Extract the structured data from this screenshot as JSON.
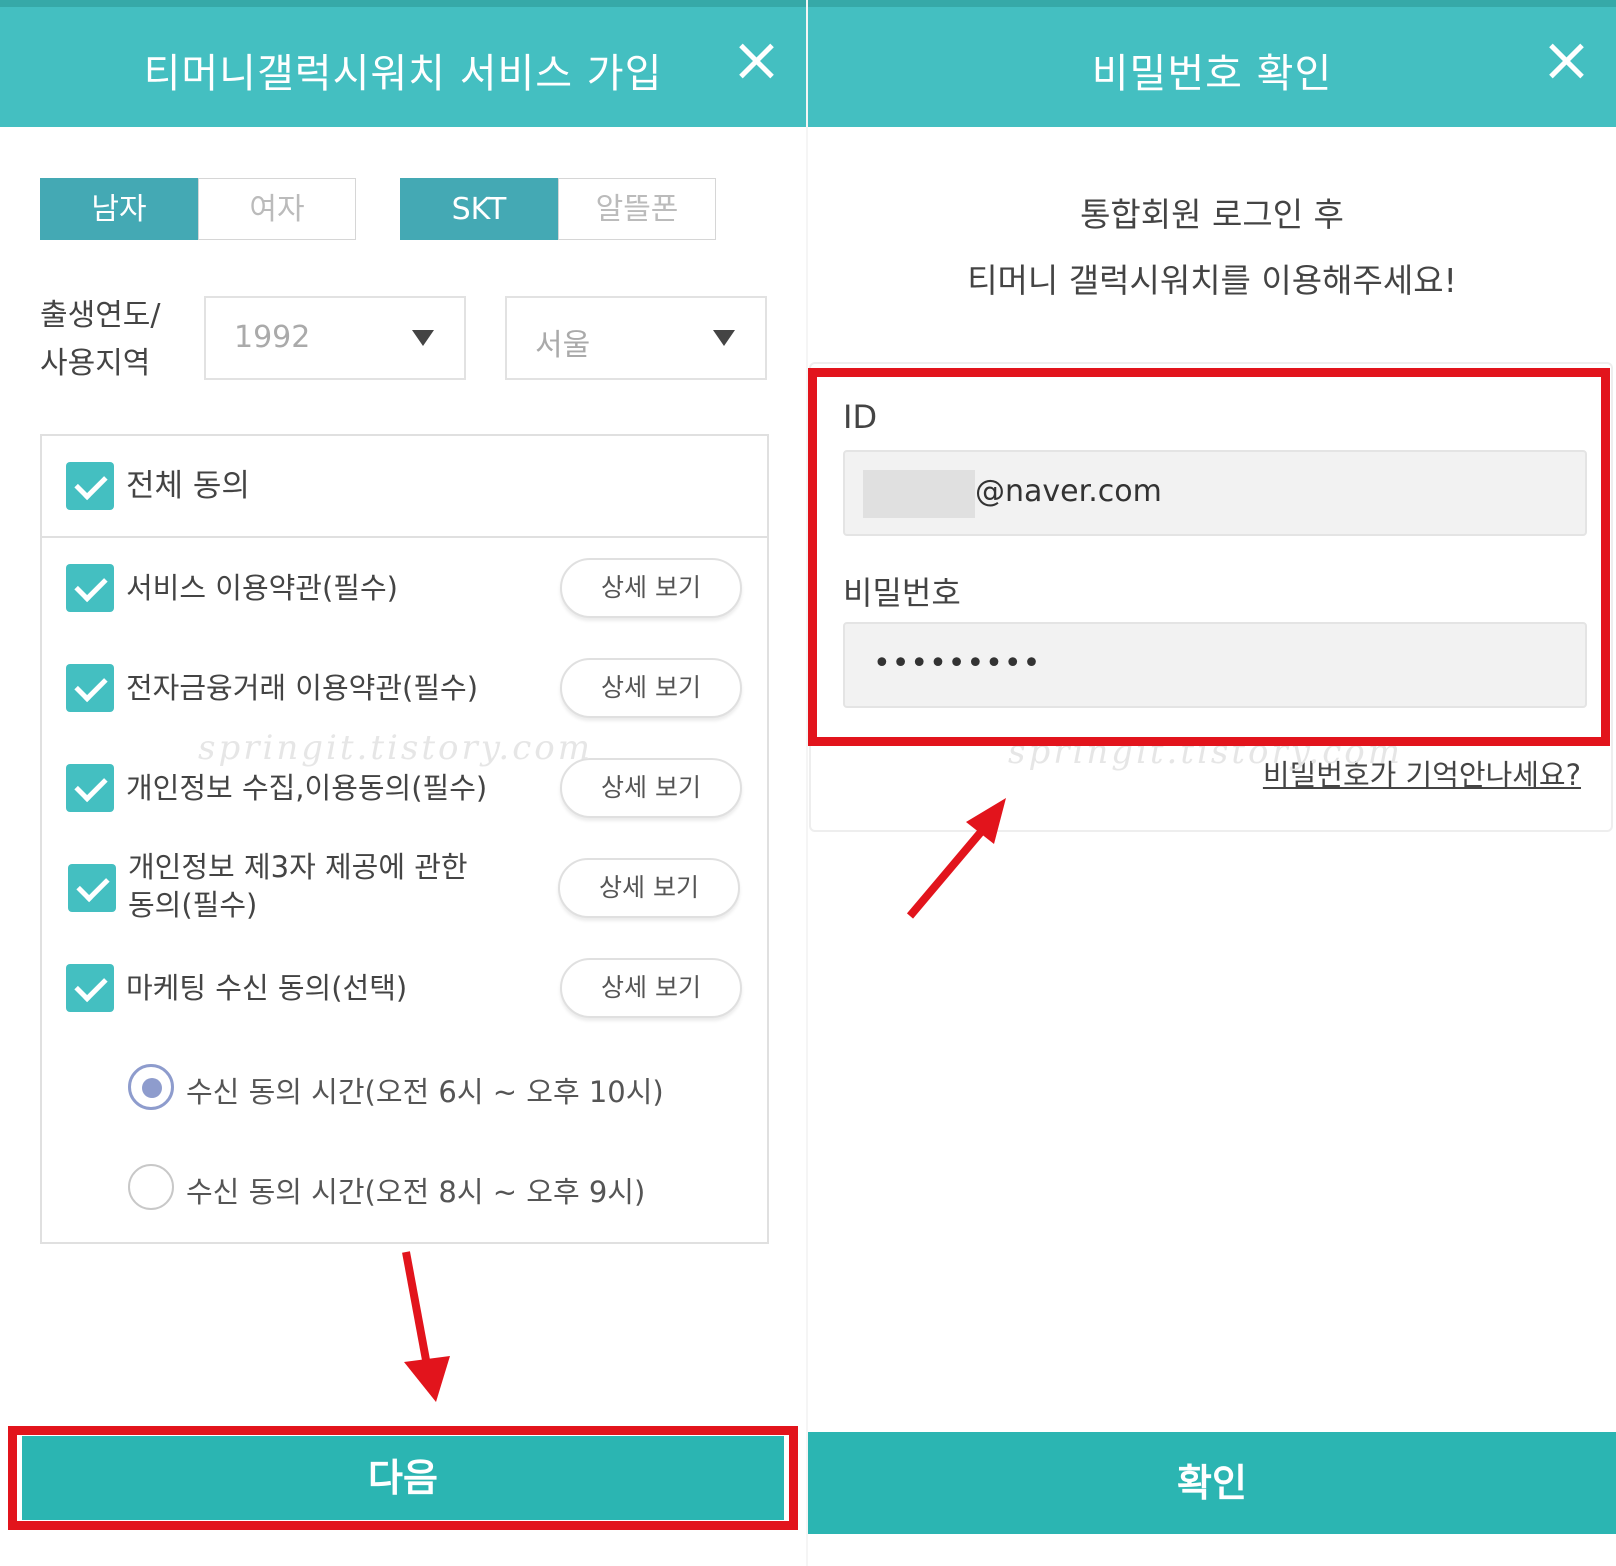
{
  "left": {
    "title": "티머니갤럭시워치 서비스 가입",
    "gender": {
      "male": "남자",
      "female": "여자"
    },
    "carrier": {
      "skt": "SKT",
      "mvno": "알뜰폰"
    },
    "birth_label_line1": "출생연도/",
    "birth_label_line2": "사용지역",
    "year_value": "1992",
    "region_value": "서울",
    "agree_all": "전체 동의",
    "terms": [
      {
        "label": "서비스 이용약관(필수)",
        "button": "상세 보기"
      },
      {
        "label": "전자금융거래 이용약관(필수)",
        "button": "상세 보기"
      },
      {
        "label": "개인정보 수집,이용동의(필수)",
        "button": "상세 보기"
      },
      {
        "label": "개인정보 제3자 제공에 관한 동의(필수)",
        "label_line1": "개인정보 제3자 제공에 관한",
        "label_line2": "동의(필수)",
        "button": "상세 보기"
      },
      {
        "label": "마케팅 수신 동의(선택)",
        "button": "상세 보기"
      }
    ],
    "radio_options": [
      {
        "label": "수신 동의 시간(오전 6시 ~ 오후 10시)",
        "selected": true
      },
      {
        "label": "수신 동의 시간(오전 8시 ~ 오후 9시)",
        "selected": false
      }
    ],
    "next_button": "다음",
    "watermark": "springit.tistory.com"
  },
  "right": {
    "title": "비밀번호 확인",
    "subtitle_line1": "통합회원 로그인 후",
    "subtitle_line2": "티머니 갤럭시워치를 이용해주세요!",
    "id_label": "ID",
    "id_value_suffix": "@naver.com",
    "password_label": "비밀번호",
    "password_value": "•••••••••",
    "forgot_link": "비밀번호가 기억안나세요?",
    "confirm_button": "확인",
    "watermark": "springit.tistory.com"
  },
  "colors": {
    "header": "#44bfc1",
    "accent": "#44a9b4",
    "button": "#2bb5b2",
    "highlight": "#e2141c"
  }
}
